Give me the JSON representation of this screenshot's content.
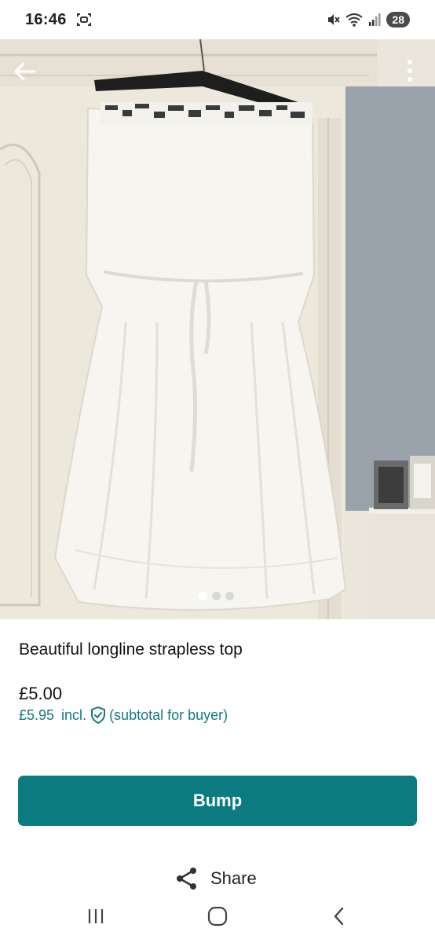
{
  "status_bar": {
    "time": "16:46",
    "battery": "28",
    "icons": [
      "screenshot-icon",
      "mute-icon",
      "wifi-icon",
      "signal-icon",
      "battery-icon"
    ]
  },
  "listing": {
    "title": "Beautiful longline strapless top",
    "price": "£5.00",
    "buyer_price": "£5.95",
    "incl_label": "incl.",
    "subtotal_note": "(subtotal for buyer)",
    "image_count": 3,
    "active_image": 1
  },
  "actions": {
    "bump_label": "Bump",
    "share_label": "Share"
  },
  "colors": {
    "accent": "#0b7b80",
    "accent_text": "#127a80"
  },
  "nav": {
    "icons": [
      "recent-apps-icon",
      "home-icon",
      "back-icon"
    ]
  }
}
